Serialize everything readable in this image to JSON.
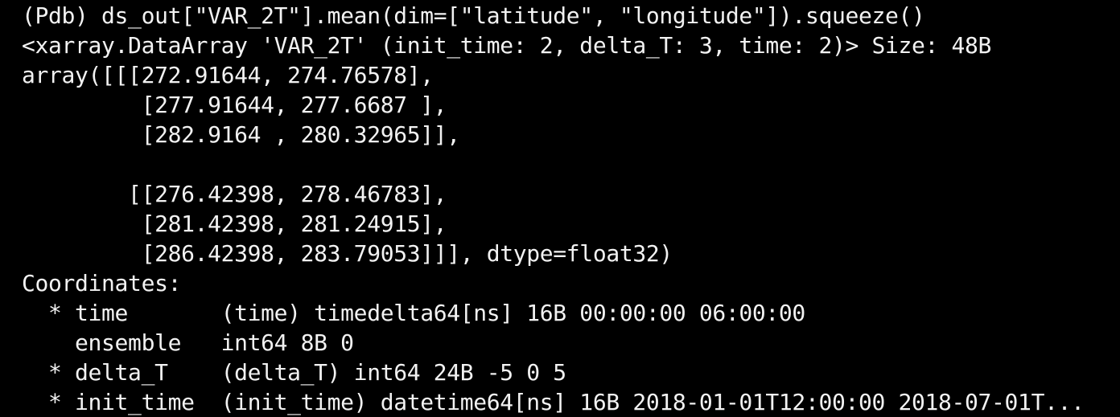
{
  "terminal": {
    "lines": [
      "(Pdb) ds_out[\"VAR_2T\"].mean(dim=[\"latitude\", \"longitude\"]).squeeze()",
      "<xarray.DataArray 'VAR_2T' (init_time: 2, delta_T: 3, time: 2)> Size: 48B",
      "array([[[272.91644, 274.76578],",
      "         [277.91644, 277.6687 ],",
      "         [282.9164 , 280.32965]],",
      "",
      "        [[276.42398, 278.46783],",
      "         [281.42398, 281.24915],",
      "         [286.42398, 283.79053]]], dtype=float32)",
      "Coordinates:",
      "  * time       (time) timedelta64[ns] 16B 00:00:00 06:00:00",
      "    ensemble   int64 8B 0",
      "  * delta_T    (delta_T) int64 24B -5 0 5",
      "  * init_time  (init_time) datetime64[ns] 16B 2018-01-01T12:00:00 2018-07-01T..."
    ]
  }
}
